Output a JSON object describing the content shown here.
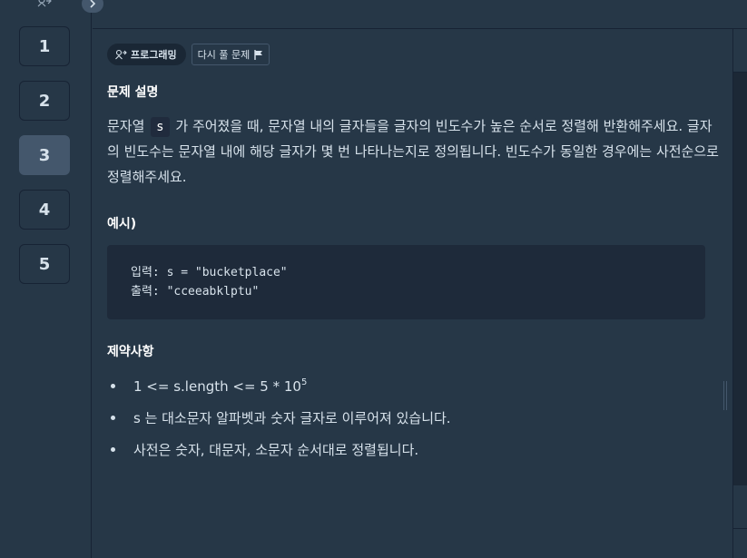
{
  "sidebar": {
    "question_numbers": [
      "1",
      "2",
      "3",
      "4",
      "5"
    ],
    "active": "3"
  },
  "tags": {
    "category": "프로그래밍",
    "retry": "다시 풀 문제"
  },
  "sections": {
    "description_title": "문제 설명",
    "description_pre": "문자열 ",
    "description_code": "s",
    "description_post": " 가 주어졌을 때, 문자열 내의 글자들을 글자의 빈도수가 높은 순서로 정렬해 반환해주세요. 글자의 빈도수는 문자열 내에 해당 글자가 몇 번 나타나는지로 정의됩니다. 빈도수가 동일한 경우에는 사전순으로 정렬해주세요.",
    "example_title": "예시)",
    "example_input": "입력: s = \"bucketplace\"",
    "example_output": "출력: \"cceeabklptu\"",
    "constraints_title": "제약사항",
    "constraint_1_base": "1 <= s.length <= 5 * 10",
    "constraint_1_exp": "5",
    "constraint_2": "s 는 대소문자 알파벳과 숫자 글자로 이루어져 있습니다.",
    "constraint_3": "사전은 숫자, 대문자, 소문자 순서대로 정렬됩니다."
  },
  "icons": {
    "collapse": "chevron-right-icon",
    "category": "robot-icon",
    "retry": "flag-icon"
  },
  "colors": {
    "background": "#263747",
    "active_number": "#44576c",
    "code_block": "#1e2a3a"
  }
}
